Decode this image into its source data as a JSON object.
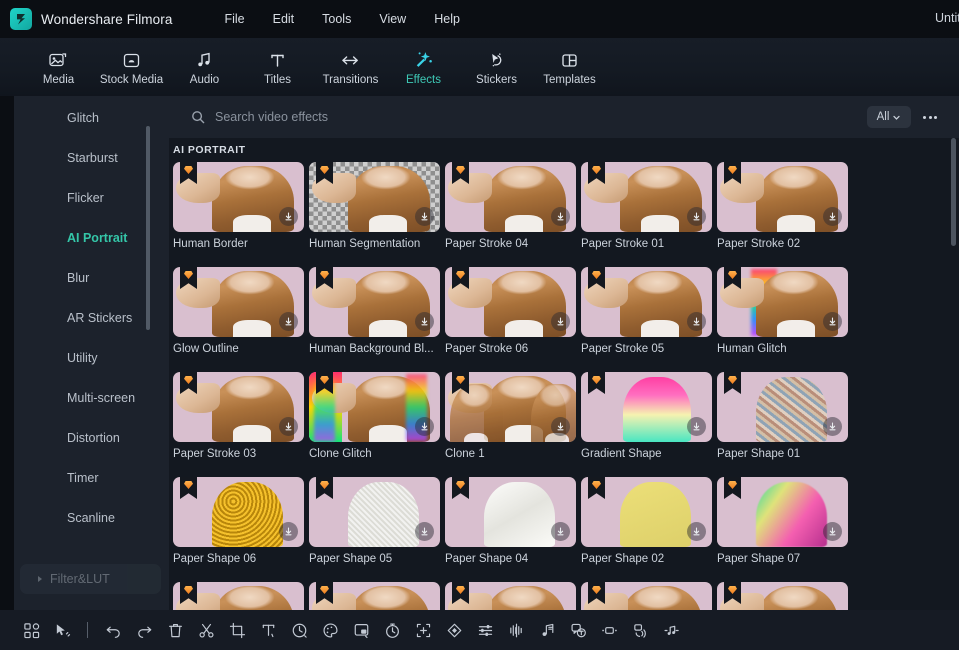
{
  "titlebar": {
    "logo_icon": "filmora-logo-icon",
    "app_title": "Wondershare Filmora",
    "menus": [
      "File",
      "Edit",
      "Tools",
      "View",
      "Help"
    ],
    "project_name": "Untitled"
  },
  "tabs": [
    {
      "label": "Media",
      "icon": "media-icon",
      "active": false
    },
    {
      "label": "Stock Media",
      "icon": "stock-media-icon",
      "active": false
    },
    {
      "label": "Audio",
      "icon": "audio-note-icon",
      "active": false
    },
    {
      "label": "Titles",
      "icon": "titles-text-icon",
      "active": false
    },
    {
      "label": "Transitions",
      "icon": "transitions-icon",
      "active": false
    },
    {
      "label": "Effects",
      "icon": "effects-wand-icon",
      "active": true
    },
    {
      "label": "Stickers",
      "icon": "stickers-icon",
      "active": false
    },
    {
      "label": "Templates",
      "icon": "templates-icon",
      "active": false
    }
  ],
  "sidebar": {
    "items": [
      {
        "label": "Glitch",
        "active": false
      },
      {
        "label": "Starburst",
        "active": false
      },
      {
        "label": "Flicker",
        "active": false
      },
      {
        "label": "AI Portrait",
        "active": true
      },
      {
        "label": "Blur",
        "active": false
      },
      {
        "label": "AR Stickers",
        "active": false
      },
      {
        "label": "Utility",
        "active": false
      },
      {
        "label": "Multi-screen",
        "active": false
      },
      {
        "label": "Distortion",
        "active": false
      },
      {
        "label": "Timer",
        "active": false
      },
      {
        "label": "Scanline",
        "active": false
      }
    ],
    "group": {
      "label": "Filter&LUT",
      "icon": "caret-right-icon",
      "expanded": false
    },
    "collapse_icon": "chevron-left-icon",
    "accent_color": "#34c6a8"
  },
  "search": {
    "icon": "search-icon",
    "placeholder": "Search video effects",
    "value": "",
    "filter_label": "All",
    "filter_icon": "chevron-down-icon",
    "more_icon": "more-horizontal-icon"
  },
  "main": {
    "section_title": "AI PORTRAIT",
    "badge_icon": "premium-gem-icon",
    "download_icon": "download-icon",
    "effects": [
      {
        "label": "Human Border",
        "thumb": "portrait-pink"
      },
      {
        "label": "Human Segmentation",
        "thumb": "portrait-checker"
      },
      {
        "label": "Paper Stroke 04",
        "thumb": "portrait-pink"
      },
      {
        "label": "Paper Stroke 01",
        "thumb": "portrait-pink"
      },
      {
        "label": "Paper Stroke 02",
        "thumb": "portrait-pink"
      },
      {
        "label": "Glow Outline",
        "thumb": "portrait-pink"
      },
      {
        "label": "Human Background Bl...",
        "thumb": "portrait-pink"
      },
      {
        "label": "Paper Stroke 06",
        "thumb": "portrait-pink"
      },
      {
        "label": "Paper Stroke 05",
        "thumb": "portrait-pink"
      },
      {
        "label": "Human Glitch",
        "thumb": "portrait-glitch"
      },
      {
        "label": "Paper Stroke 03",
        "thumb": "portrait-pink"
      },
      {
        "label": "Clone Glitch",
        "thumb": "clone-glitch"
      },
      {
        "label": "Clone 1",
        "thumb": "clone-plain"
      },
      {
        "label": "Gradient Shape",
        "thumb": "gradient-shape"
      },
      {
        "label": "Paper Shape 01",
        "thumb": "shape-collage"
      },
      {
        "label": "Paper Shape 06",
        "thumb": "shape-gold"
      },
      {
        "label": "Paper Shape 05",
        "thumb": "shape-white1"
      },
      {
        "label": "Paper Shape 04",
        "thumb": "shape-white2"
      },
      {
        "label": "Paper Shape 02",
        "thumb": "shape-yellow"
      },
      {
        "label": "Paper Shape 07",
        "thumb": "shape-rainbow"
      },
      {
        "label": "",
        "thumb": "portrait-pink"
      },
      {
        "label": "",
        "thumb": "portrait-pink"
      },
      {
        "label": "",
        "thumb": "portrait-pink"
      },
      {
        "label": "",
        "thumb": "portrait-pink"
      },
      {
        "label": "",
        "thumb": "portrait-pink"
      }
    ]
  },
  "toolbar": {
    "tools": [
      {
        "icon": "apps-grid-icon",
        "name": "apps-grid"
      },
      {
        "icon": "select-cursor-icon",
        "name": "select-cursor"
      },
      {
        "icon": "separator",
        "name": "separator"
      },
      {
        "icon": "undo-icon",
        "name": "undo"
      },
      {
        "icon": "redo-icon",
        "name": "redo"
      },
      {
        "icon": "trash-icon",
        "name": "delete"
      },
      {
        "icon": "scissors-icon",
        "name": "split"
      },
      {
        "icon": "crop-icon",
        "name": "crop"
      },
      {
        "icon": "text-icon",
        "name": "text"
      },
      {
        "icon": "speed-icon",
        "name": "speed"
      },
      {
        "icon": "color-palette-icon",
        "name": "color"
      },
      {
        "icon": "picture-in-picture-icon",
        "name": "picture-in-picture"
      },
      {
        "icon": "stopwatch-icon",
        "name": "stopwatch"
      },
      {
        "icon": "add-marker-icon",
        "name": "add-marker"
      },
      {
        "icon": "keyframe-icon",
        "name": "keyframe"
      },
      {
        "icon": "sliders-icon",
        "name": "adjust"
      },
      {
        "icon": "waveform-icon",
        "name": "audio-waveform"
      },
      {
        "icon": "audio-beat-icon",
        "name": "audio-beat"
      },
      {
        "icon": "speech-to-text-icon",
        "name": "speech-to-text"
      },
      {
        "icon": "green-screen-icon",
        "name": "green-screen"
      },
      {
        "icon": "auto-sync-icon",
        "name": "auto-sync"
      },
      {
        "icon": "audio-ducking-icon",
        "name": "audio-ducking"
      }
    ]
  }
}
